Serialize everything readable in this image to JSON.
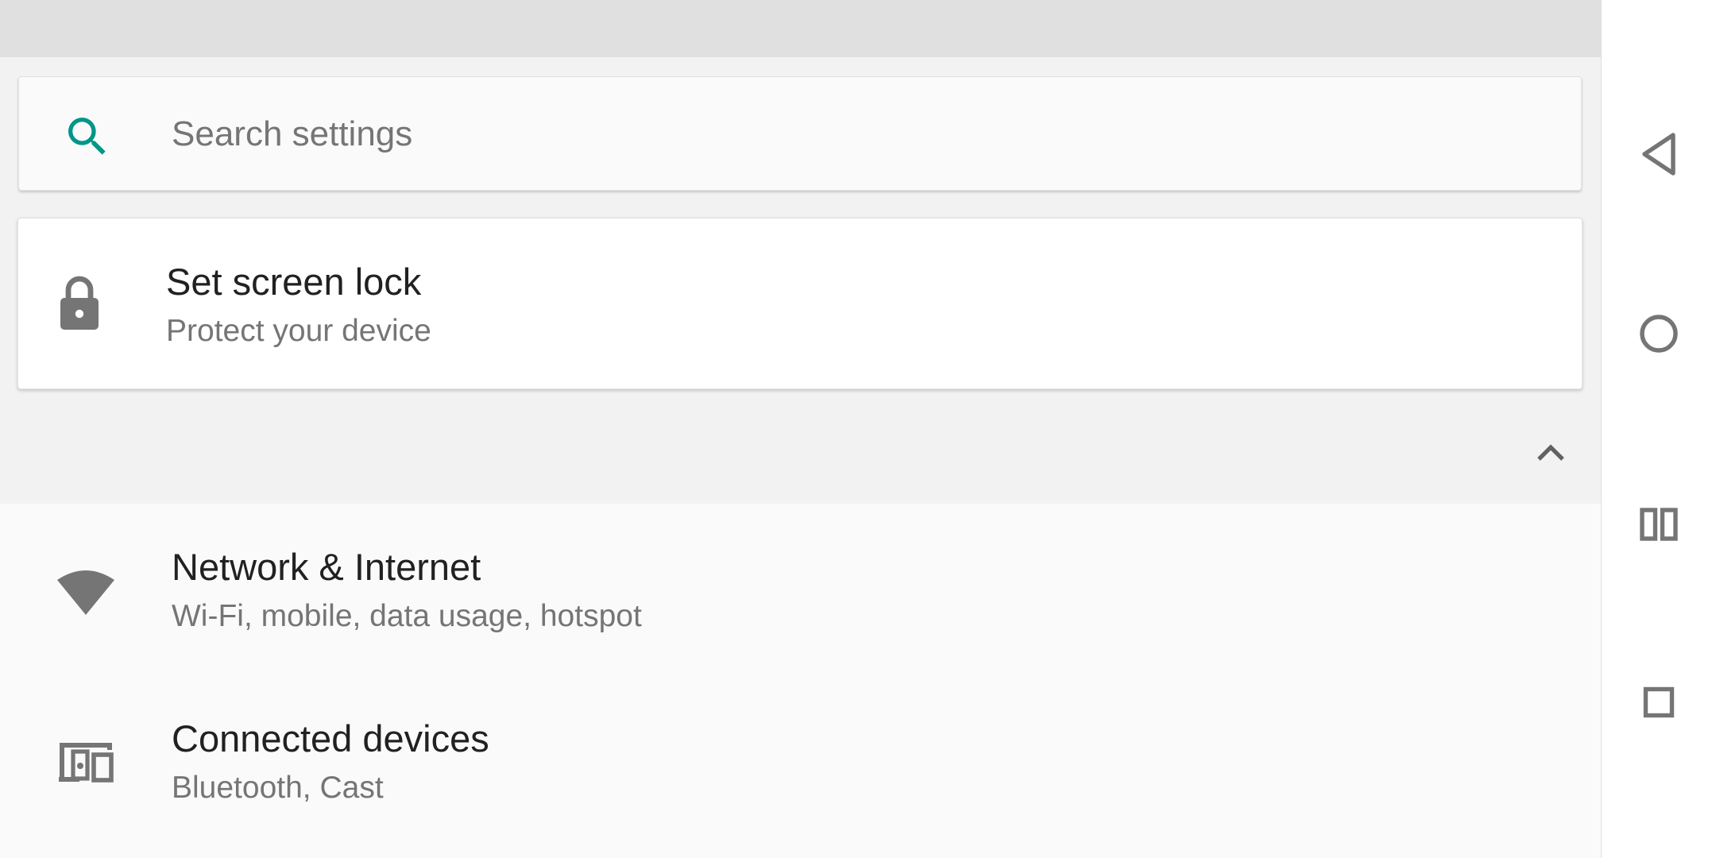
{
  "search": {
    "placeholder": "Search settings",
    "icon": "search-icon",
    "accent_color": "#009688"
  },
  "suggestion": {
    "title": "Set screen lock",
    "summary": "Protect your device",
    "icon": "lock-icon"
  },
  "collapse": {
    "icon": "chevron-up-icon"
  },
  "settings_items": [
    {
      "title": "Network & Internet",
      "summary": "Wi-Fi, mobile, data usage, hotspot",
      "icon": "wifi-icon"
    },
    {
      "title": "Connected devices",
      "summary": "Bluetooth, Cast",
      "icon": "devices-icon"
    }
  ],
  "navigation": {
    "buttons": [
      "back-icon",
      "home-icon",
      "split-screen-icon",
      "recents-icon"
    ]
  },
  "colors": {
    "icon_gray": "#757575",
    "title_text": "#212121",
    "summary_text": "#757575",
    "status_bar": "#e0e0e0"
  }
}
